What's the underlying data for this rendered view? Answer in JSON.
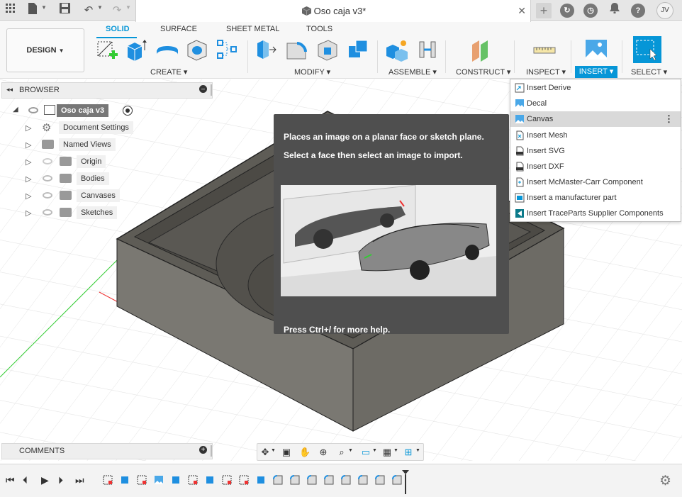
{
  "window": {
    "title": "Oso caja v3*"
  },
  "titlebar": {
    "icons": [
      "grid-icon",
      "file-icon",
      "save-icon",
      "undo-icon",
      "redo-icon",
      "close-tab-icon",
      "new-tab-icon",
      "extensions-icon",
      "job-status-icon",
      "notifications-icon",
      "help-icon"
    ],
    "user_initials": "JV"
  },
  "toolbar": {
    "workspace_label": "DESIGN",
    "tabs": [
      "SOLID",
      "SURFACE",
      "SHEET METAL",
      "TOOLS"
    ],
    "active_tab": "SOLID",
    "groups": {
      "create": "CREATE",
      "modify": "MODIFY",
      "assemble": "ASSEMBLE",
      "construct": "CONSTRUCT",
      "inspect": "INSPECT",
      "insert": "INSERT",
      "select": "SELECT"
    }
  },
  "browser": {
    "title": "BROWSER",
    "root": "Oso caja v3",
    "items": [
      {
        "label": "Document Settings",
        "icon": "gear-icon"
      },
      {
        "label": "Named Views",
        "icon": "folder-icon"
      },
      {
        "label": "Origin",
        "icon": "folder-icon"
      },
      {
        "label": "Bodies",
        "icon": "folder-icon"
      },
      {
        "label": "Canvases",
        "icon": "folder-icon"
      },
      {
        "label": "Sketches",
        "icon": "folder-icon"
      }
    ]
  },
  "tooltip": {
    "line1": "Places an image on a planar face or sketch plane.",
    "line2": "Select a face then select an image to import.",
    "help": "Press Ctrl+/ for more help."
  },
  "insert_menu": {
    "items": [
      {
        "label": "Insert Derive",
        "icon": "derive-icon"
      },
      {
        "label": "Decal",
        "icon": "decal-icon"
      },
      {
        "label": "Canvas",
        "icon": "canvas-icon"
      },
      {
        "label": "Insert Mesh",
        "icon": "mesh-icon"
      },
      {
        "label": "Insert SVG",
        "icon": "svg-icon"
      },
      {
        "label": "Insert DXF",
        "icon": "dxf-icon"
      },
      {
        "label": "Insert McMaster-Carr Component",
        "icon": "mcmaster-icon"
      },
      {
        "label": "Insert a manufacturer part",
        "icon": "manufacturer-icon"
      },
      {
        "label": "Insert TraceParts Supplier Components",
        "icon": "traceparts-icon"
      }
    ],
    "highlighted": "Canvas"
  },
  "comments": {
    "title": "COMMENTS"
  },
  "colors": {
    "accent": "#0696d7",
    "tooltip_bg": "#4f4f4f",
    "model": "#5a5852",
    "axis_red": "#e33",
    "axis_green": "#3c3"
  }
}
